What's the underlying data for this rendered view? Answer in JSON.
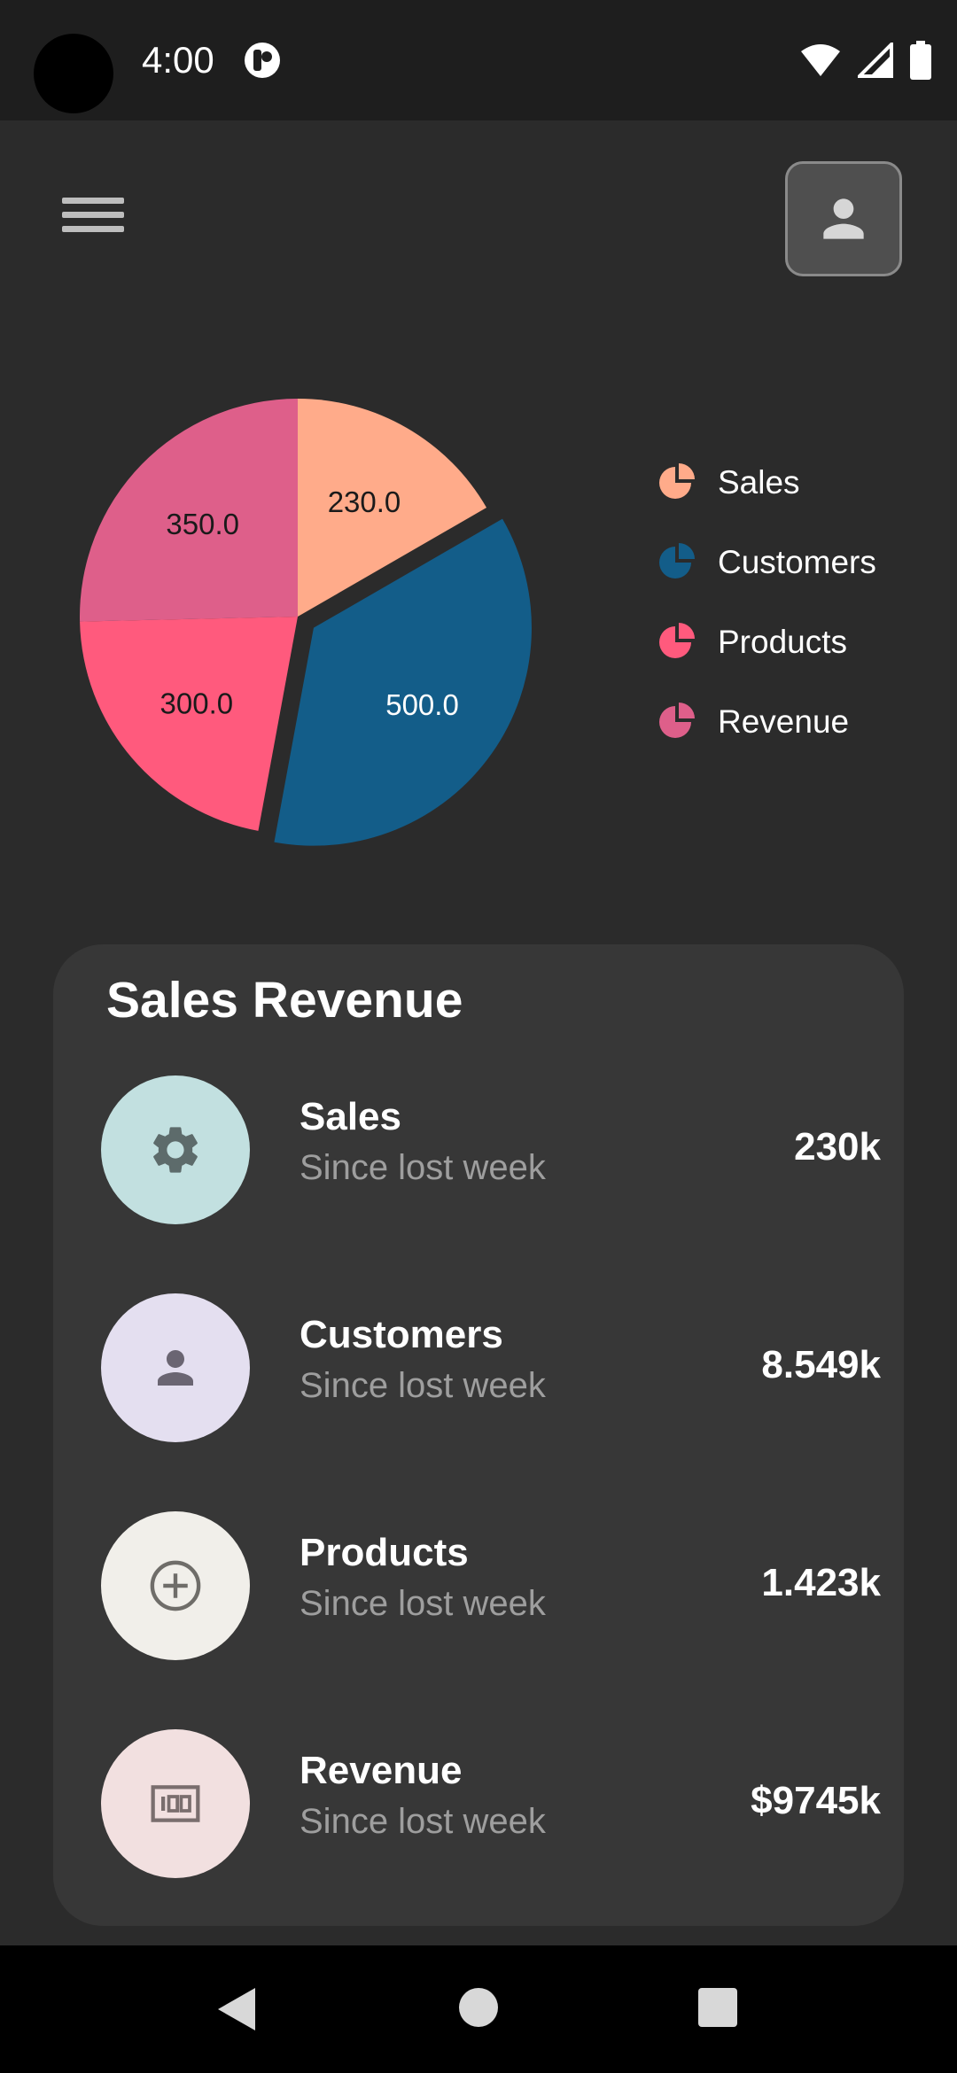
{
  "status_bar": {
    "time": "4:00"
  },
  "header": {
    "menu_icon": "hamburger-menu-icon",
    "profile_icon": "person-icon"
  },
  "chart_data": {
    "type": "pie",
    "title": "",
    "slices": [
      {
        "name": "Sales",
        "label": "230.0",
        "value": 230,
        "color": "#FFAB8A"
      },
      {
        "name": "Customers",
        "label": "500.0",
        "value": 500,
        "color": "#135D89"
      },
      {
        "name": "Products",
        "label": "300.0",
        "value": 300,
        "color": "#FF5A7D"
      },
      {
        "name": "Revenue",
        "label": "350.0",
        "value": 350,
        "color": "#DE5F8A"
      }
    ],
    "exploded": "Customers",
    "legend_position": "right"
  },
  "card": {
    "title": "Sales Revenue",
    "items": [
      {
        "title": "Sales",
        "subtitle": "Since lost week",
        "value": "230k",
        "icon": "gear-icon",
        "circle_color": "#C2E0E0"
      },
      {
        "title": "Customers",
        "subtitle": "Since lost week",
        "value": "8.549k",
        "icon": "person-icon",
        "circle_color": "#E4DFF0"
      },
      {
        "title": "Products",
        "subtitle": "Since lost week",
        "value": "1.423k",
        "icon": "add-circle-icon",
        "circle_color": "#F1EFEA"
      },
      {
        "title": "Revenue",
        "subtitle": "Since lost week",
        "value": "$9745k",
        "icon": "money-icon",
        "circle_color": "#F2E0E0"
      }
    ]
  },
  "nav": {
    "back_icon": "back-triangle-icon",
    "home_icon": "home-circle-icon",
    "recents_icon": "recents-square-icon"
  }
}
